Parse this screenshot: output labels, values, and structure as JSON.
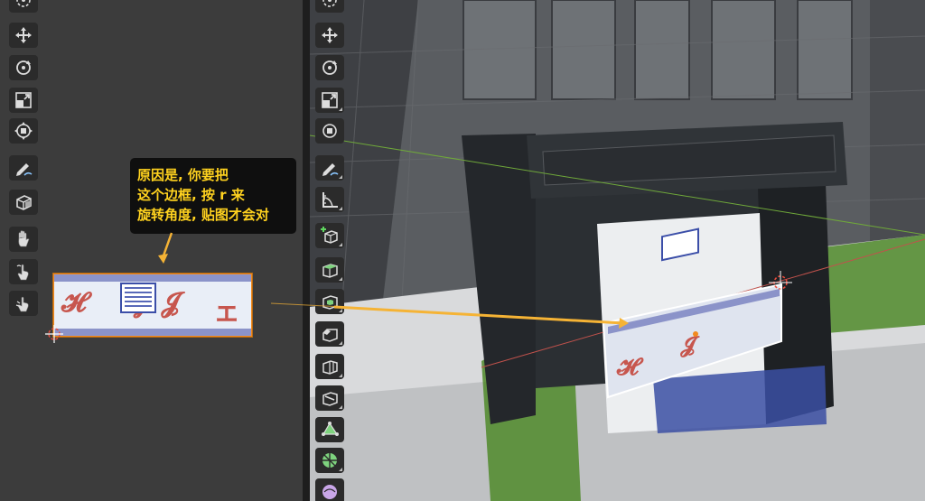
{
  "tooltip": {
    "line1": "原因是, 你要把",
    "line2": "这个边框, 按 r 来",
    "line3": "旋转角度, 贴图才会对"
  },
  "uv_toolbar": {
    "tools": [
      {
        "name": "cursor-icon"
      },
      {
        "name": "move-icon"
      },
      {
        "name": "rotate-icon"
      },
      {
        "name": "scale-icon"
      },
      {
        "name": "transform-icon"
      },
      {
        "name": "annotate-icon"
      },
      {
        "name": "cube-project-icon"
      },
      {
        "name": "grab-icon"
      },
      {
        "name": "relax-icon"
      },
      {
        "name": "pinch-icon"
      }
    ]
  },
  "viewport_toolbar": {
    "tools": [
      {
        "name": "cursor-icon"
      },
      {
        "name": "move-icon"
      },
      {
        "name": "rotate-icon"
      },
      {
        "name": "scale-icon"
      },
      {
        "name": "transform-icon"
      },
      {
        "name": "annotate-icon"
      },
      {
        "name": "measure-icon"
      },
      {
        "name": "add-cube-icon"
      },
      {
        "name": "extrude-icon"
      },
      {
        "name": "inset-icon"
      },
      {
        "name": "bevel-icon"
      },
      {
        "name": "loop-cut-icon"
      },
      {
        "name": "knife-icon"
      },
      {
        "name": "poly-build-icon"
      },
      {
        "name": "spin-icon"
      },
      {
        "name": "smooth-icon"
      }
    ]
  },
  "colors": {
    "tooltip_text": "#ffd21f",
    "arrow": "#f5b335",
    "selection": "#f28a1e",
    "grass": "#4f8a2a"
  }
}
